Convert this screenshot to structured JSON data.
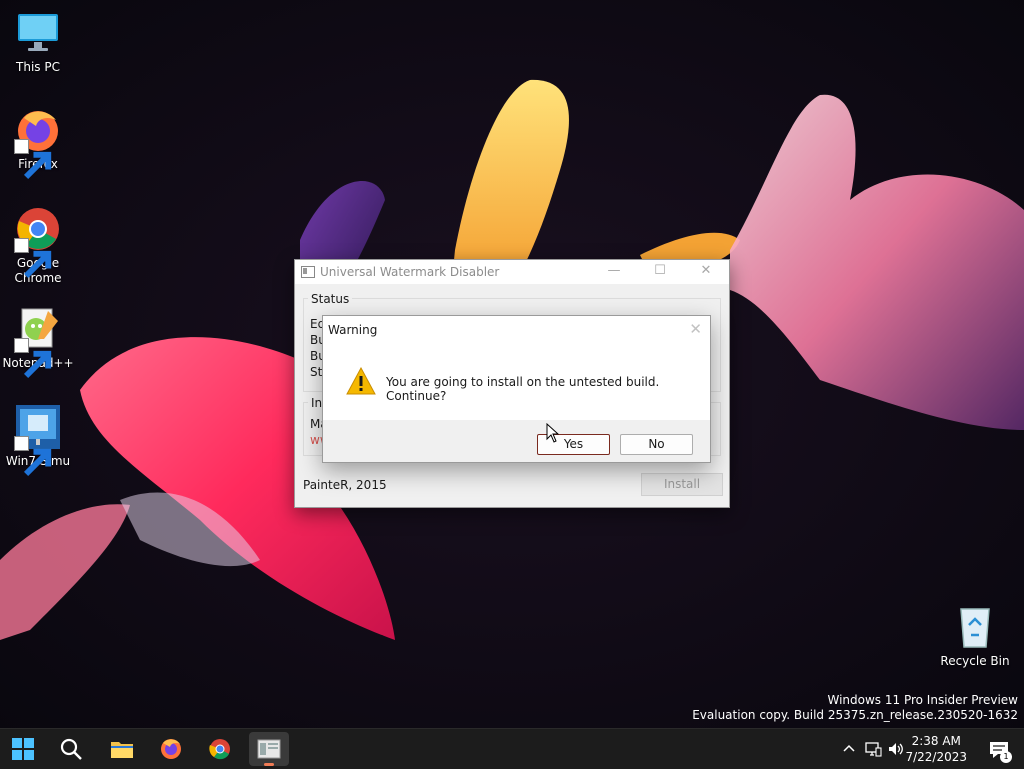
{
  "desktop": {
    "icons": [
      {
        "label": "This PC",
        "icon": "this-pc-icon"
      },
      {
        "label": "Firefox",
        "icon": "firefox-icon"
      },
      {
        "label": "Google Chrome",
        "icon": "chrome-icon"
      },
      {
        "label": "Notepad++",
        "icon": "notepadpp-icon"
      },
      {
        "label": "Win7 Simu",
        "icon": "win7-simu-icon"
      },
      {
        "label": "Recycle Bin",
        "icon": "recycle-bin-icon"
      }
    ],
    "watermark": {
      "line1": "Windows 11 Pro Insider Preview",
      "line2": "Evaluation copy. Build 25375.zn_release.230520-1632"
    }
  },
  "app_window": {
    "title": "Universal Watermark Disabler",
    "status_group_label": "Status",
    "status_rows": [
      "Ed",
      "Bu",
      "Bu",
      "Sta"
    ],
    "info_group_label": "Inf",
    "info_rows": [
      "Ma",
      "ww"
    ],
    "footer_text": "PainteR, 2015",
    "install_label": "Install",
    "titlebar_buttons": {
      "minimize": "—",
      "maximize": "☐",
      "close": "✕"
    }
  },
  "dialog": {
    "title": "Warning",
    "message": "You are going to install on the untested build. Continue?",
    "yes_label": "Yes",
    "no_label": "No",
    "close_glyph": "✕"
  },
  "taskbar": {
    "items": [
      "start-icon",
      "search-icon",
      "file-explorer-icon",
      "firefox-icon",
      "chrome-icon",
      "app-window-icon"
    ],
    "clock_time": "2:38 AM",
    "clock_date": "7/22/2023",
    "notification_count": "1"
  },
  "colors": {
    "accent": "#f07c56",
    "dialog_yes_border": "#7a2a1f",
    "taskbar": "#1c1c1c",
    "warning_yellow": "#f5b800"
  }
}
